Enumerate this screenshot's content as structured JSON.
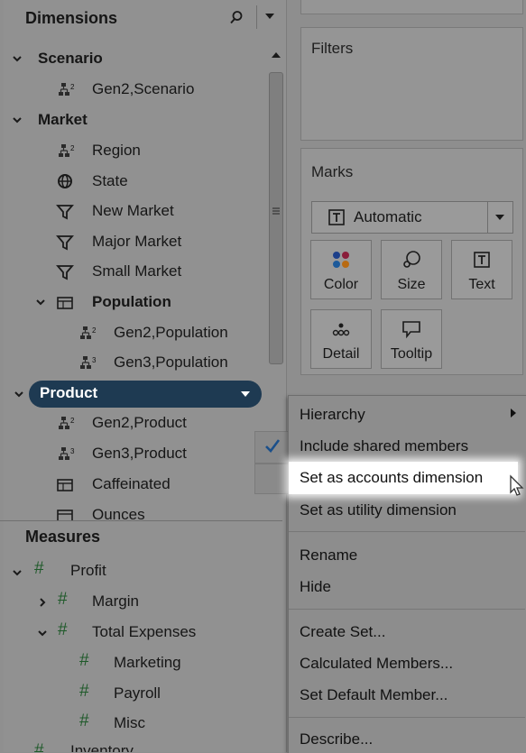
{
  "dimensions": {
    "title": "Dimensions",
    "items": [
      {
        "label": "Scenario"
      },
      {
        "label": "Gen2,Scenario"
      },
      {
        "label": "Market"
      },
      {
        "label": "Region"
      },
      {
        "label": "State"
      },
      {
        "label": "New Market"
      },
      {
        "label": "Major Market"
      },
      {
        "label": "Small Market"
      },
      {
        "label": "Population"
      },
      {
        "label": "Gen2,Population"
      },
      {
        "label": "Gen3,Population"
      },
      {
        "label": "Product"
      },
      {
        "label": "Gen2,Product"
      },
      {
        "label": "Gen3,Product"
      },
      {
        "label": "Caffeinated"
      },
      {
        "label": "Ounces"
      }
    ]
  },
  "measures": {
    "title": "Measures",
    "items": [
      {
        "label": "Profit"
      },
      {
        "label": "Margin"
      },
      {
        "label": "Total Expenses"
      },
      {
        "label": "Marketing"
      },
      {
        "label": "Payroll"
      },
      {
        "label": "Misc"
      },
      {
        "label": "Inventory"
      }
    ]
  },
  "filters": {
    "title": "Filters"
  },
  "marks": {
    "title": "Marks",
    "select_value": "Automatic",
    "buttons": [
      {
        "label": "Color",
        "icon": "color-dots-icon"
      },
      {
        "label": "Size",
        "icon": "size-icon"
      },
      {
        "label": "Text",
        "icon": "text-icon"
      },
      {
        "label": "Detail",
        "icon": "detail-icon"
      },
      {
        "label": "Tooltip",
        "icon": "tooltip-icon"
      }
    ]
  },
  "context_menu": {
    "items": [
      {
        "label": "Hierarchy"
      },
      {
        "label": "Include shared members"
      },
      {
        "label": "Set as accounts dimension"
      },
      {
        "label": "Set as utility dimension"
      },
      {
        "label": "Rename"
      },
      {
        "label": "Hide"
      },
      {
        "label": "Create Set..."
      },
      {
        "label": "Calculated Members..."
      },
      {
        "label": "Set Default Member..."
      },
      {
        "label": "Describe..."
      }
    ]
  },
  "colors": {
    "selection": "#1e3a52",
    "highlight": "#ffffff",
    "check": "#1a4f8a"
  }
}
